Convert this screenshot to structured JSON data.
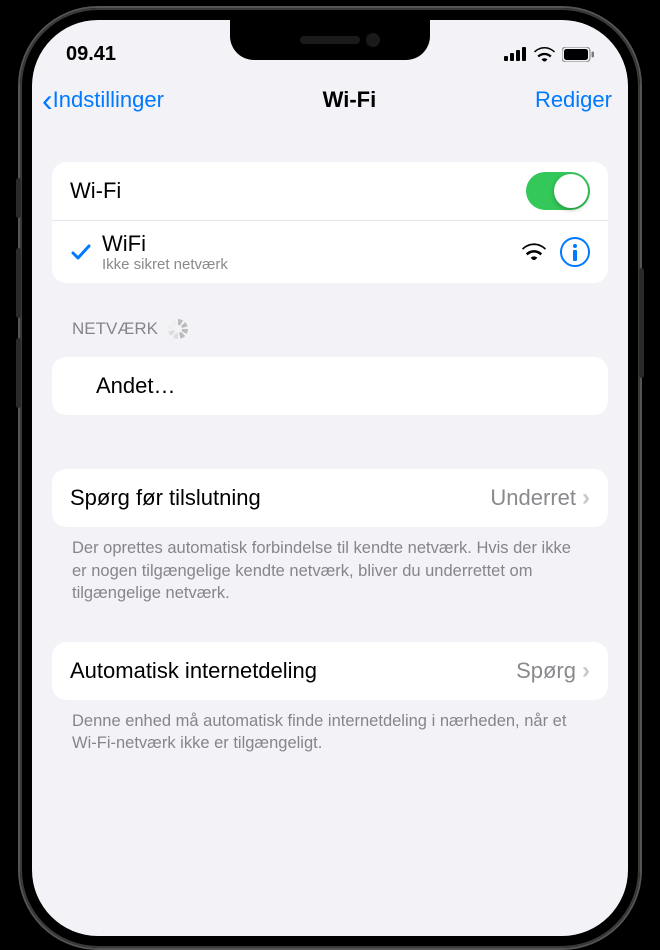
{
  "status": {
    "time": "09.41"
  },
  "nav": {
    "back": "Indstillinger",
    "title": "Wi-Fi",
    "edit": "Rediger"
  },
  "wifi": {
    "toggle_label": "Wi-Fi",
    "toggle_on": true,
    "connected": {
      "name": "WiFi",
      "subtitle": "Ikke sikret netværk"
    }
  },
  "networks": {
    "header": "NETVÆRK",
    "other": "Andet…"
  },
  "ask": {
    "label": "Spørg før tilslutning",
    "value": "Underret",
    "footer": "Der oprettes automatisk forbindelse til kendte netværk. Hvis der ikke er nogen tilgængelige kendte netværk, bliver du underrettet om tilgængelige netværk."
  },
  "hotspot": {
    "label": "Automatisk internetdeling",
    "value": "Spørg",
    "footer": "Denne enhed må automatisk finde internetdeling i nærheden, når et Wi-Fi-netværk ikke er tilgængeligt."
  }
}
